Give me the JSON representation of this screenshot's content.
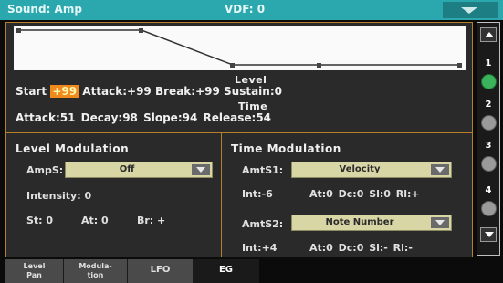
{
  "header": {
    "title": "Sound: Amp",
    "vdf": "VDF: 0"
  },
  "level": {
    "heading": "Level",
    "start_label": "Start",
    "start_value": "+99",
    "attack": "Attack:+99",
    "break": "Break:+99",
    "sustain": "Sustain:0"
  },
  "time": {
    "heading": "Time",
    "attack": "Attack:51",
    "decay": "Decay:98",
    "slope": "Slope:94",
    "release": "Release:54"
  },
  "level_modulation": {
    "title": "Level Modulation",
    "amps_label": "AmpS:",
    "amps_value": "Off",
    "intensity": "Intensity: 0",
    "st": "St: 0",
    "at": "At: 0",
    "br": "Br: +"
  },
  "time_modulation": {
    "title": "Time Modulation",
    "amts1_label": "AmtS1:",
    "amts1_value": "Velocity",
    "int1": "Int:-6",
    "params1": "At:0 Dc:0 Sl:0 Rl:+",
    "amts2_label": "AmtS2:",
    "amts2_value": "Note Number",
    "int2": "Int:+4",
    "params2": "At:0 Dc:0 Sl:- Rl:-"
  },
  "sidebar": {
    "items": [
      {
        "num": "1",
        "color": "#3bb35a"
      },
      {
        "num": "2",
        "color": "#9a9a9a"
      },
      {
        "num": "3",
        "color": "#9a9a9a"
      },
      {
        "num": "4",
        "color": "#9a9a9a"
      }
    ]
  },
  "tabs": [
    {
      "line1": "Level",
      "line2": "Pan"
    },
    {
      "line1": "Modula-",
      "line2": "tion"
    },
    {
      "line1": "LFO",
      "line2": ""
    },
    {
      "line1": "EG",
      "line2": ""
    }
  ],
  "colors": {
    "header": "#2aa8ae",
    "highlight": "#f08a1c",
    "border": "#b87f2a",
    "dropdown": "#d9d6a6"
  }
}
